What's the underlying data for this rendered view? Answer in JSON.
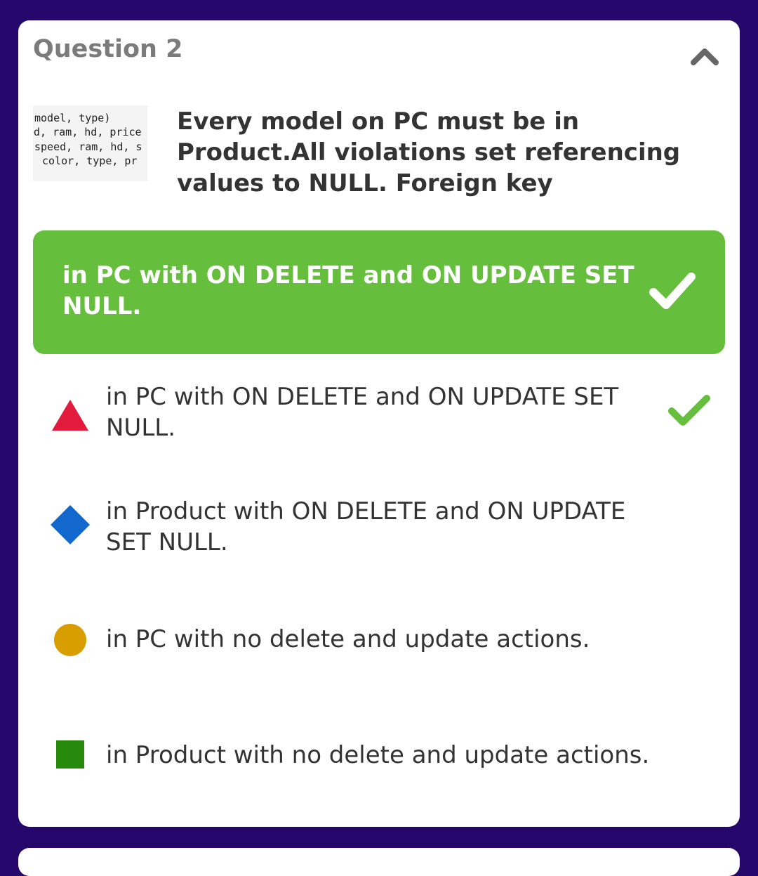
{
  "question": {
    "title": "Question 2",
    "thumbnail_lines": [
      "model, type)",
      "ed, ram, hd, price",
      "speed, ram, hd, s",
      " color, type, pr"
    ],
    "text": "Every model on PC must be in Product.All violations set referencing values to NULL. Foreign key"
  },
  "correct_answer": {
    "label": "in PC with ON DELETE and ON UPDATE SET NULL."
  },
  "options": [
    {
      "shape": "triangle-icon",
      "color": "#e21b3c",
      "label": "in PC with ON DELETE and ON UPDATE SET NULL.",
      "correct": true
    },
    {
      "shape": "diamond-icon",
      "color": "#1368ce",
      "label": "in Product with ON DELETE and ON UPDATE SET NULL.",
      "correct": false
    },
    {
      "shape": "circle-icon",
      "color": "#d89e00",
      "label": "in PC with no delete and update actions.",
      "correct": false
    },
    {
      "shape": "square-icon",
      "color": "#26890c",
      "label": "in Product with no delete and update actions.",
      "correct": false
    }
  ],
  "colors": {
    "background": "#25076b",
    "correct_green": "#66bf3c"
  }
}
